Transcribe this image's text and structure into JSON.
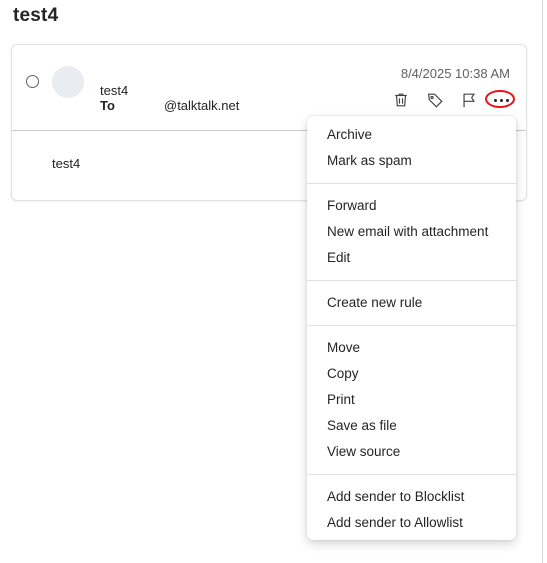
{
  "message": {
    "subject": "test4",
    "sender": "test4",
    "to_label": "To",
    "to_value": "@talktalk.net",
    "date": "8/4/2025 10:38 AM",
    "body": "test4"
  },
  "actions": {
    "icons": [
      "trash-icon",
      "tag-icon",
      "flag-icon",
      "more-icon"
    ],
    "highlight_color": "#e8141b"
  },
  "menu": {
    "group1": [
      "Archive",
      "Mark as spam"
    ],
    "group2": [
      "Forward",
      "New email with attachment",
      "Edit"
    ],
    "group3": [
      "Create new rule"
    ],
    "group4": [
      "Move",
      "Copy",
      "Print",
      "Save as file",
      "View source"
    ],
    "group5": [
      "Add sender to Blocklist",
      "Add sender to Allowlist"
    ]
  }
}
